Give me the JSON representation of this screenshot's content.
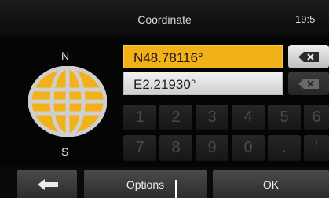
{
  "header": {
    "title": "Coordinate",
    "clock": "19:5"
  },
  "compass": {
    "north_label": "N",
    "south_label": "S",
    "globe_color": "#f2b118"
  },
  "fields": {
    "latitude_value": "N48.78116°",
    "longitude_value": "E2.21930°",
    "accent_color": "#f2b118"
  },
  "keypad": {
    "row1": [
      "1",
      "2",
      "3",
      "4",
      "5",
      "6"
    ],
    "row2": [
      "7",
      "8",
      "9",
      "0",
      ".",
      "'"
    ]
  },
  "footer": {
    "back_icon": "arrow-left-icon",
    "options_label": "Options",
    "ok_label": "OK"
  }
}
